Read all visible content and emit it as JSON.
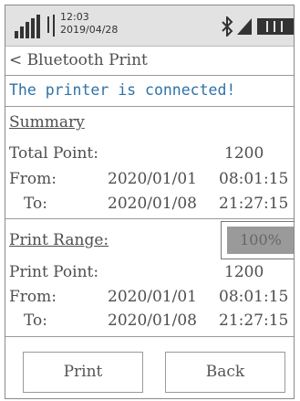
{
  "status": {
    "time": "12:03",
    "date": "2019/04/28"
  },
  "header": {
    "back_glyph": "<",
    "title": "Bluetooth Print"
  },
  "message": "The printer is connected!",
  "summary": {
    "heading": "Summary",
    "total_label": "Total Point:",
    "total_value": "1200",
    "from_label": "From:",
    "from_date": "2020/01/01",
    "from_time": "08:01:15",
    "to_label": "To:",
    "to_date": "2020/01/08",
    "to_time": "21:27:15"
  },
  "print_range": {
    "label": "Print Range:",
    "value": "100%"
  },
  "print_point": {
    "label": "Print Point:",
    "value": "1200",
    "from_label": "From:",
    "from_date": "2020/01/01",
    "from_time": "08:01:15",
    "to_label": "To:",
    "to_date": "2020/01/08",
    "to_time": "21:27:15"
  },
  "buttons": {
    "print": "Print",
    "back": "Back"
  }
}
